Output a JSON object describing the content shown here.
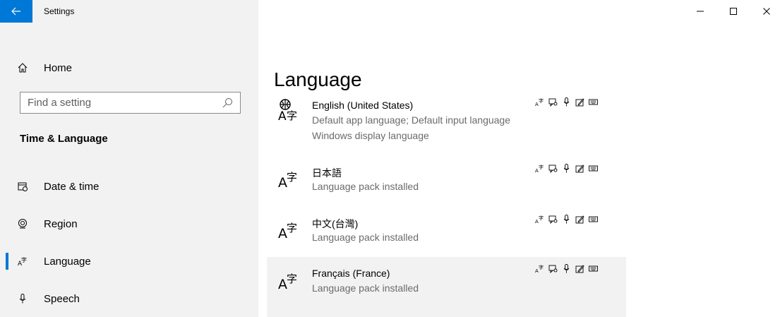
{
  "window": {
    "title": "Settings",
    "minimize_glyph": "—",
    "maximize_glyph": "☐",
    "close_glyph": "✕"
  },
  "sidebar": {
    "home_label": "Home",
    "search_placeholder": "Find a setting",
    "section_title": "Time & Language",
    "items": [
      {
        "label": "Date & time",
        "icon": "calendar-clock-icon",
        "active": false
      },
      {
        "label": "Region",
        "icon": "globe-icon",
        "active": false
      },
      {
        "label": "Language",
        "icon": "language-icon",
        "active": true
      },
      {
        "label": "Speech",
        "icon": "microphone-icon",
        "active": false
      }
    ]
  },
  "main": {
    "title": "Language",
    "languages": [
      {
        "name": "English (United States)",
        "details": [
          "Default app language; Default input language",
          "Windows display language"
        ],
        "icon": "globe-language-icon",
        "selected": false
      },
      {
        "name": "日本語",
        "details": [
          "Language pack installed"
        ],
        "icon": "language-icon",
        "selected": false
      },
      {
        "name": "中文(台灣)",
        "details": [
          "Language pack installed"
        ],
        "icon": "language-icon",
        "selected": false
      },
      {
        "name": "Français (France)",
        "details": [
          "Language pack installed"
        ],
        "icon": "language-icon",
        "selected": true
      }
    ],
    "feature_icons": [
      "display-language-icon",
      "text-to-speech-icon",
      "speech-recognition-icon",
      "handwriting-icon",
      "keyboard-icon"
    ]
  },
  "colors": {
    "accent": "#0078d7",
    "sidebar_bg": "#f2f2f2",
    "secondary_text": "#6b6b6b"
  }
}
